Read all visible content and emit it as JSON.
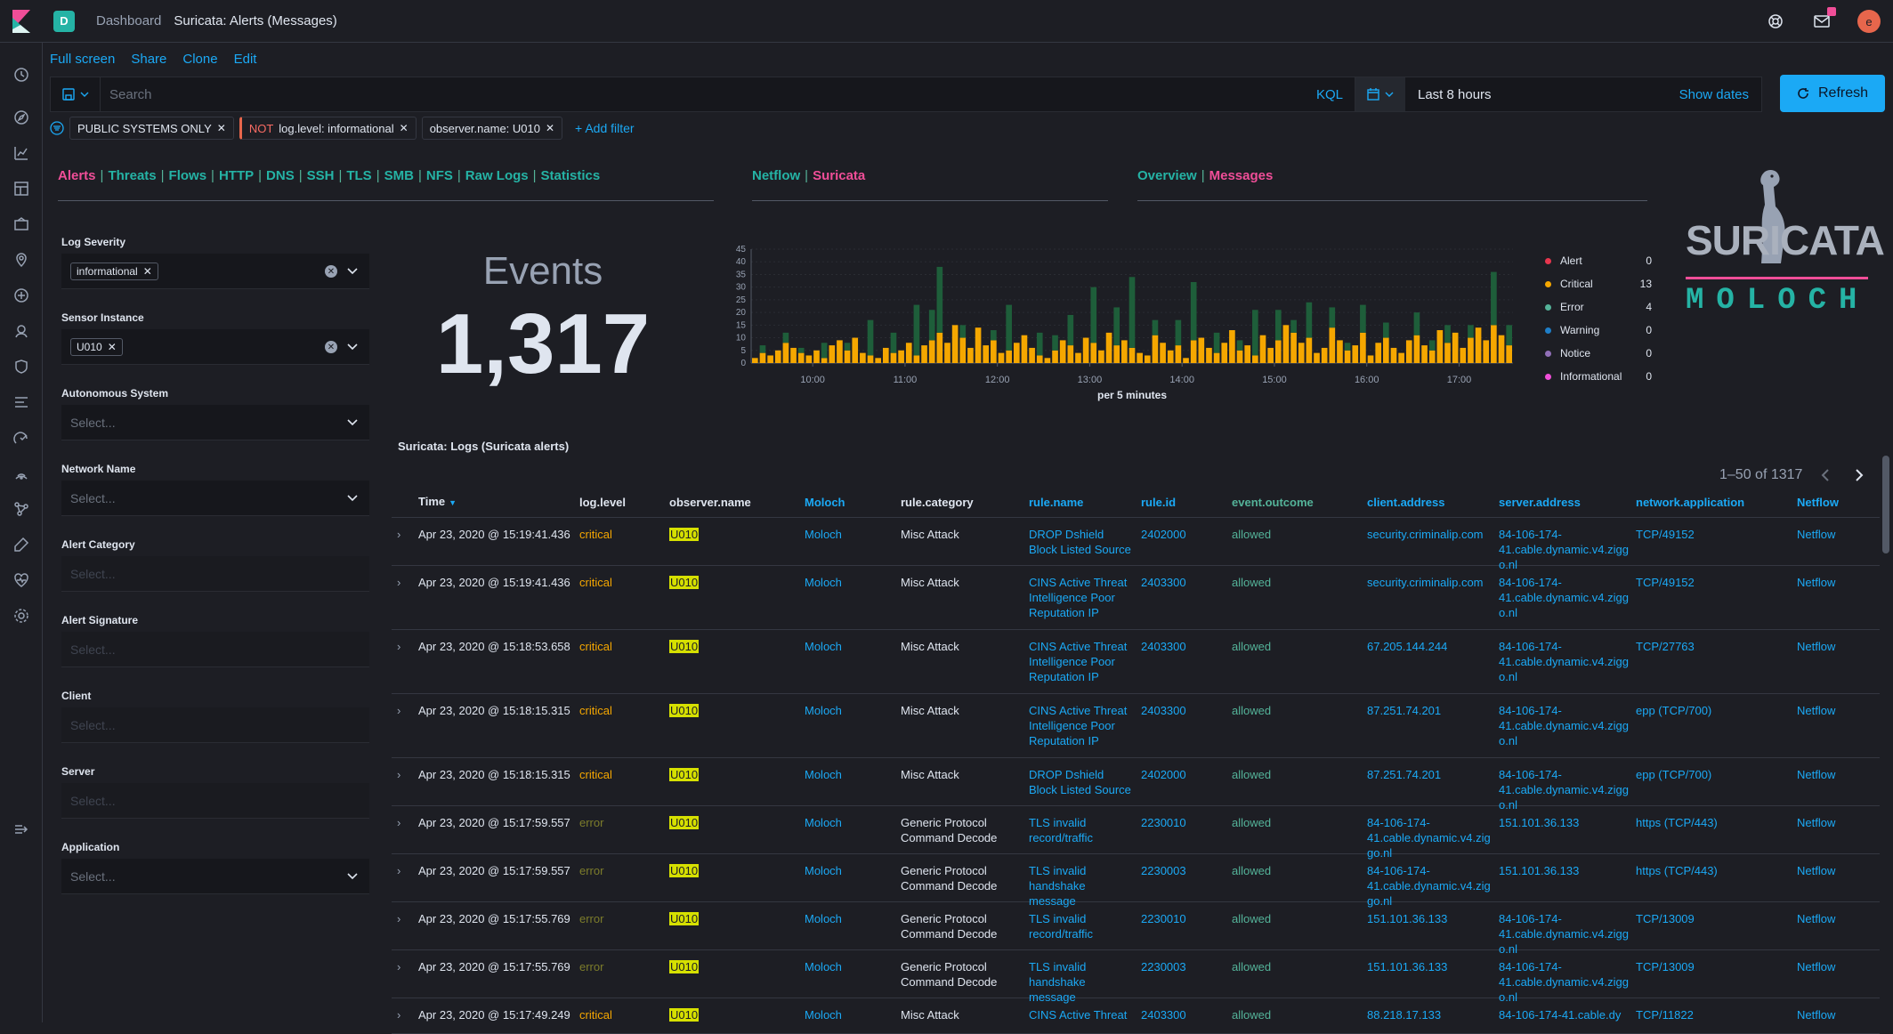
{
  "header": {
    "breadcrumb_root": "Dashboard",
    "breadcrumb_current": "Suricata: Alerts (Messages)",
    "space_letter": "D",
    "user_initial": "e"
  },
  "actions": [
    "Full screen",
    "Share",
    "Clone",
    "Edit"
  ],
  "query": {
    "placeholder": "Search",
    "language": "KQL",
    "time_range": "Last 8 hours",
    "show_dates": "Show dates",
    "refresh": "Refresh"
  },
  "filters": [
    {
      "label": "PUBLIC SYSTEMS ONLY",
      "negated": false
    },
    {
      "prefix": "NOT",
      "label": "log.level: informational",
      "negated": true
    },
    {
      "label": "observer.name: U010",
      "negated": false
    }
  ],
  "add_filter": "+ Add filter",
  "nav_sections": [
    {
      "items": [
        "Alerts",
        "Threats",
        "Flows",
        "HTTP",
        "DNS",
        "SSH",
        "TLS",
        "SMB",
        "NFS",
        "Raw Logs",
        "Statistics"
      ],
      "active": "Alerts"
    },
    {
      "items": [
        "Netflow",
        "Suricata"
      ],
      "active": "Suricata"
    },
    {
      "items": [
        "Overview",
        "Messages"
      ],
      "active": "Messages"
    }
  ],
  "logo": {
    "top": "SURICATA",
    "bottom": "MOLOCH"
  },
  "controls": [
    {
      "label": "Log Severity",
      "chip": "informational",
      "placeholder": ""
    },
    {
      "label": "Sensor Instance",
      "chip": "U010",
      "placeholder": ""
    },
    {
      "label": "Autonomous System",
      "chip": "",
      "placeholder": "Select..."
    },
    {
      "label": "Network Name",
      "chip": "",
      "placeholder": "Select..."
    },
    {
      "label": "Alert Category",
      "chip": "",
      "placeholder": "Select..."
    },
    {
      "label": "Alert Signature",
      "chip": "",
      "placeholder": "Select..."
    },
    {
      "label": "Client",
      "chip": "",
      "placeholder": "Select..."
    },
    {
      "label": "Server",
      "chip": "",
      "placeholder": "Select..."
    },
    {
      "label": "Application",
      "chip": "",
      "placeholder": "Select..."
    }
  ],
  "metric": {
    "label": "Events",
    "value": "1,317"
  },
  "chart_data": {
    "type": "bar",
    "stacked": true,
    "xlabel": "per 5 minutes",
    "ylim": [
      0,
      45
    ],
    "yticks": [
      0,
      5,
      10,
      15,
      20,
      25,
      30,
      35,
      40,
      45
    ],
    "xtick_labels": [
      "10:00",
      "11:00",
      "12:00",
      "13:00",
      "14:00",
      "15:00",
      "16:00",
      "17:00"
    ],
    "xticks_at_bin": [
      8,
      20,
      32,
      44,
      56,
      68,
      80,
      92
    ],
    "series": [
      {
        "name": "Critical",
        "color": "#f5a700",
        "values": [
          2,
          4,
          3,
          5,
          8,
          6,
          4,
          3,
          5,
          2,
          7,
          9,
          5,
          10,
          4,
          3,
          2,
          6,
          4,
          5,
          8,
          3,
          7,
          9,
          12,
          8,
          15,
          10,
          6,
          14,
          7,
          9,
          4,
          5,
          8,
          11,
          6,
          3,
          2,
          5,
          9,
          7,
          4,
          10,
          8,
          5,
          12,
          7,
          9,
          6,
          4,
          3,
          11,
          8,
          5,
          7,
          2,
          9,
          10,
          6,
          4,
          8,
          13,
          5,
          7,
          3,
          11,
          6,
          9,
          15,
          12,
          8,
          10,
          4,
          6,
          14,
          9,
          5,
          7,
          12,
          3,
          8,
          10,
          6,
          4,
          9,
          11,
          7,
          5,
          13,
          8,
          12,
          6,
          10,
          14,
          9,
          15,
          11,
          7
        ]
      },
      {
        "name": "Error",
        "color": "#1e5e3a",
        "values": [
          0,
          3,
          0,
          0,
          4,
          0,
          2,
          0,
          0,
          6,
          0,
          0,
          3,
          0,
          0,
          14,
          0,
          0,
          8,
          0,
          0,
          20,
          0,
          12,
          26,
          0,
          0,
          5,
          0,
          0,
          0,
          4,
          0,
          18,
          0,
          0,
          0,
          9,
          0,
          6,
          0,
          12,
          0,
          0,
          22,
          0,
          0,
          15,
          0,
          28,
          0,
          0,
          6,
          0,
          0,
          10,
          0,
          23,
          0,
          0,
          8,
          0,
          0,
          4,
          0,
          18,
          0,
          0,
          12,
          0,
          5,
          0,
          14,
          0,
          0,
          8,
          0,
          3,
          0,
          11,
          0,
          0,
          6,
          0,
          0,
          0,
          9,
          0,
          4,
          0,
          7,
          0,
          0,
          5,
          0,
          0,
          21,
          0,
          8
        ]
      }
    ]
  },
  "legend": [
    {
      "name": "Alert",
      "count": "0",
      "color": "#e7364e"
    },
    {
      "name": "Critical",
      "count": "13",
      "color": "#f5a700"
    },
    {
      "name": "Error",
      "count": "4",
      "color": "#54b399"
    },
    {
      "name": "Warning",
      "count": "0",
      "color": "#1e7ec8"
    },
    {
      "name": "Notice",
      "count": "0",
      "color": "#9170b8"
    },
    {
      "name": "Informational",
      "count": "0",
      "color": "#f04ed8"
    }
  ],
  "table": {
    "title": "Suricata: Logs (Suricata alerts)",
    "pagination": "1–50 of 1317",
    "columns": [
      "Time",
      "log.level",
      "observer.name",
      "Moloch",
      "rule.category",
      "rule.name",
      "rule.id",
      "event.outcome",
      "client.address",
      "server.address",
      "network.application",
      "Netflow"
    ],
    "rows": [
      {
        "time": "Apr 23, 2020 @ 15:19:41.436",
        "level": "critical",
        "observer": "U010",
        "moloch": "Moloch",
        "category": "Misc Attack",
        "rule": "DROP Dshield Block Listed Source",
        "rid": "2402000",
        "outcome": "allowed",
        "client": "security.criminalip.com",
        "server": "84-106-174-41.cable.dynamic.v4.ziggo.nl",
        "app": "TCP/49152",
        "netflow": "Netflow"
      },
      {
        "time": "Apr 23, 2020 @ 15:19:41.436",
        "level": "critical",
        "observer": "U010",
        "moloch": "Moloch",
        "category": "Misc Attack",
        "rule": "CINS Active Threat Intelligence Poor Reputation IP",
        "rid": "2403300",
        "outcome": "allowed",
        "client": "security.criminalip.com",
        "server": "84-106-174-41.cable.dynamic.v4.ziggo.nl",
        "app": "TCP/49152",
        "netflow": "Netflow"
      },
      {
        "time": "Apr 23, 2020 @ 15:18:53.658",
        "level": "critical",
        "observer": "U010",
        "moloch": "Moloch",
        "category": "Misc Attack",
        "rule": "CINS Active Threat Intelligence Poor Reputation IP",
        "rid": "2403300",
        "outcome": "allowed",
        "client": "67.205.144.244",
        "server": "84-106-174-41.cable.dynamic.v4.ziggo.nl",
        "app": "TCP/27763",
        "netflow": "Netflow"
      },
      {
        "time": "Apr 23, 2020 @ 15:18:15.315",
        "level": "critical",
        "observer": "U010",
        "moloch": "Moloch",
        "category": "Misc Attack",
        "rule": "CINS Active Threat Intelligence Poor Reputation IP",
        "rid": "2403300",
        "outcome": "allowed",
        "client": "87.251.74.201",
        "server": "84-106-174-41.cable.dynamic.v4.ziggo.nl",
        "app": "epp (TCP/700)",
        "netflow": "Netflow"
      },
      {
        "time": "Apr 23, 2020 @ 15:18:15.315",
        "level": "critical",
        "observer": "U010",
        "moloch": "Moloch",
        "category": "Misc Attack",
        "rule": "DROP Dshield Block Listed Source",
        "rid": "2402000",
        "outcome": "allowed",
        "client": "87.251.74.201",
        "server": "84-106-174-41.cable.dynamic.v4.ziggo.nl",
        "app": "epp (TCP/700)",
        "netflow": "Netflow"
      },
      {
        "time": "Apr 23, 2020 @ 15:17:59.557",
        "level": "error",
        "observer": "U010",
        "moloch": "Moloch",
        "category": "Generic Protocol Command Decode",
        "rule": "TLS invalid record/traffic",
        "rid": "2230010",
        "outcome": "allowed",
        "client": "84-106-174-41.cable.dynamic.v4.ziggo.nl",
        "server": "151.101.36.133",
        "app": "https (TCP/443)",
        "netflow": "Netflow"
      },
      {
        "time": "Apr 23, 2020 @ 15:17:59.557",
        "level": "error",
        "observer": "U010",
        "moloch": "Moloch",
        "category": "Generic Protocol Command Decode",
        "rule": "TLS invalid handshake message",
        "rid": "2230003",
        "outcome": "allowed",
        "client": "84-106-174-41.cable.dynamic.v4.ziggo.nl",
        "server": "151.101.36.133",
        "app": "https (TCP/443)",
        "netflow": "Netflow"
      },
      {
        "time": "Apr 23, 2020 @ 15:17:55.769",
        "level": "error",
        "observer": "U010",
        "moloch": "Moloch",
        "category": "Generic Protocol Command Decode",
        "rule": "TLS invalid record/traffic",
        "rid": "2230010",
        "outcome": "allowed",
        "client": "151.101.36.133",
        "server": "84-106-174-41.cable.dynamic.v4.ziggo.nl",
        "app": "TCP/13009",
        "netflow": "Netflow"
      },
      {
        "time": "Apr 23, 2020 @ 15:17:55.769",
        "level": "error",
        "observer": "U010",
        "moloch": "Moloch",
        "category": "Generic Protocol Command Decode",
        "rule": "TLS invalid handshake message",
        "rid": "2230003",
        "outcome": "allowed",
        "client": "151.101.36.133",
        "server": "84-106-174-41.cable.dynamic.v4.ziggo.nl",
        "app": "TCP/13009",
        "netflow": "Netflow"
      },
      {
        "time": "Apr 23, 2020 @ 15:17:49.249",
        "level": "critical",
        "observer": "U010",
        "moloch": "Moloch",
        "category": "Misc Attack",
        "rule": "CINS Active Threat",
        "rid": "2403300",
        "outcome": "allowed",
        "client": "88.218.17.133",
        "server": "84-106-174-41.cable.dy",
        "app": "TCP/11822",
        "netflow": "Netflow"
      }
    ]
  }
}
